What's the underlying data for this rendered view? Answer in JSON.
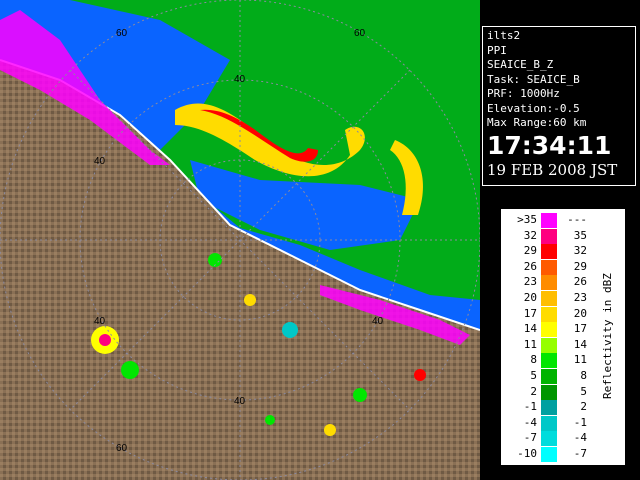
{
  "info": {
    "station": "ilts2",
    "scan": "PPI",
    "product": "SEAICE_B_Z",
    "task": "Task: SEAICE_B",
    "prf": "PRF: 1000Hz",
    "elevation": "Elevation:-0.5",
    "max_range": "Max Range:60 km",
    "time": "17:34:11",
    "date": "19 FEB 2008 JST"
  },
  "legend": {
    "title": "Reflectivity in dBZ",
    "rows": [
      {
        "lo": ">35",
        "hi": "---",
        "color": "#ff00ff"
      },
      {
        "lo": "32",
        "hi": "35",
        "color": "#ff0080"
      },
      {
        "lo": "29",
        "hi": "32",
        "color": "#ff0000"
      },
      {
        "lo": "26",
        "hi": "29",
        "color": "#ff5a00"
      },
      {
        "lo": "23",
        "hi": "26",
        "color": "#ff8c00"
      },
      {
        "lo": "20",
        "hi": "23",
        "color": "#ffbe00"
      },
      {
        "lo": "17",
        "hi": "20",
        "color": "#ffdc00"
      },
      {
        "lo": "14",
        "hi": "17",
        "color": "#ffff00"
      },
      {
        "lo": "11",
        "hi": "14",
        "color": "#96ff00"
      },
      {
        "lo": "8",
        "hi": "11",
        "color": "#00e600"
      },
      {
        "lo": "5",
        "hi": "8",
        "color": "#00b400"
      },
      {
        "lo": "2",
        "hi": "5",
        "color": "#009600"
      },
      {
        "lo": "-1",
        "hi": "2",
        "color": "#00a0a0"
      },
      {
        "lo": "-4",
        "hi": "-1",
        "color": "#00c8c8"
      },
      {
        "lo": "-7",
        "hi": "-4",
        "color": "#00dcdc"
      },
      {
        "lo": "-10",
        "hi": "-7",
        "color": "#00ffff"
      }
    ]
  },
  "range_rings": [
    "60",
    "40",
    "40",
    "40",
    "40",
    "40",
    "60",
    "60"
  ],
  "colors": {
    "land": "#8a7055",
    "sea": "#0a64ff",
    "coast": "#ffffff",
    "ring": "#8a8aa0"
  }
}
